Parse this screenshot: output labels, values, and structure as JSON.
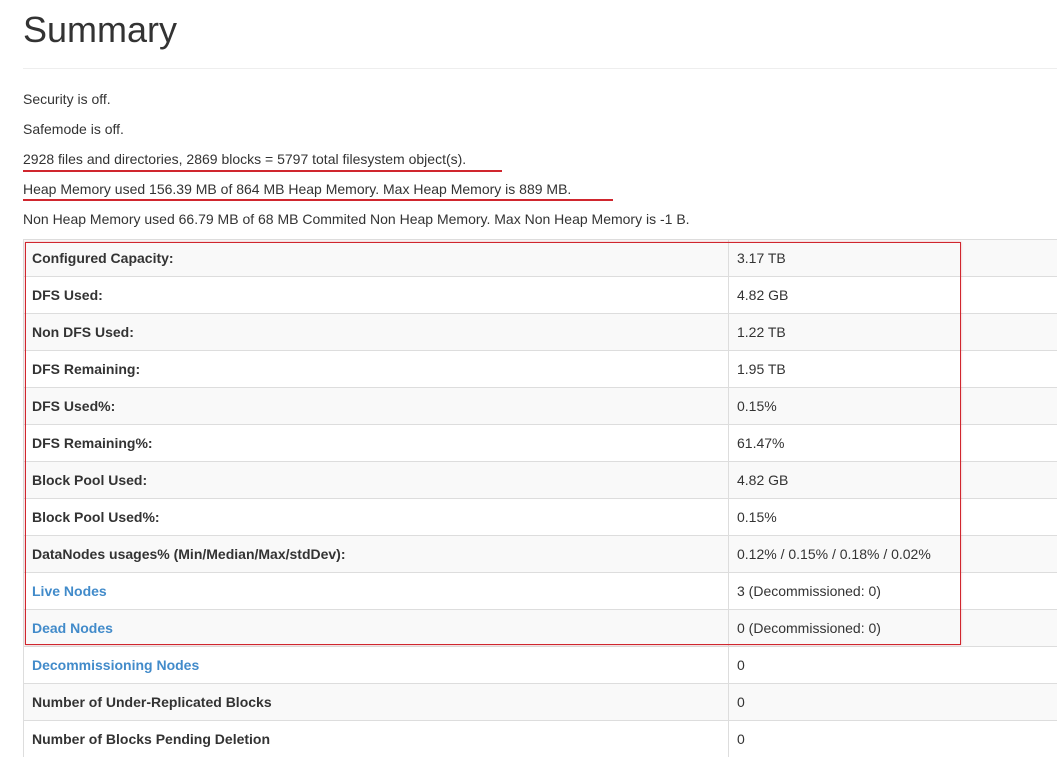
{
  "page": {
    "title": "Summary"
  },
  "info": {
    "security": "Security is off.",
    "safemode": "Safemode is off.",
    "filesystem": "2928 files and directories, 2869 blocks = 5797 total filesystem object(s).",
    "heap": "Heap Memory used 156.39 MB of 864 MB Heap Memory. Max Heap Memory is 889 MB.",
    "non_heap": "Non Heap Memory used 66.79 MB of 68 MB Commited Non Heap Memory. Max Non Heap Memory is -1 B."
  },
  "table": {
    "rows": [
      {
        "label": "Configured Capacity:",
        "value": "3.17 TB"
      },
      {
        "label": "DFS Used:",
        "value": "4.82 GB"
      },
      {
        "label": "Non DFS Used:",
        "value": "1.22 TB"
      },
      {
        "label": "DFS Remaining:",
        "value": "1.95 TB"
      },
      {
        "label": "DFS Used%:",
        "value": "0.15%"
      },
      {
        "label": "DFS Remaining%:",
        "value": "61.47%"
      },
      {
        "label": "Block Pool Used:",
        "value": "4.82 GB"
      },
      {
        "label": "Block Pool Used%:",
        "value": "0.15%"
      },
      {
        "label": "DataNodes usages% (Min/Median/Max/stdDev):",
        "value": "0.12% / 0.15% / 0.18% / 0.02%"
      },
      {
        "label": "Live Nodes",
        "value": "3 (Decommissioned: 0)"
      },
      {
        "label": "Dead Nodes",
        "value": "0 (Decommissioned: 0)"
      },
      {
        "label": "Decommissioning Nodes",
        "value": "0"
      },
      {
        "label": "Number of Under-Replicated Blocks",
        "value": "0"
      },
      {
        "label": "Number of Blocks Pending Deletion",
        "value": "0"
      }
    ]
  },
  "colors": {
    "text": "#333333",
    "link": "#428bca",
    "annotation_red": "#d0262e",
    "row_stripe": "#f9f9f9",
    "border": "#dddddd"
  }
}
